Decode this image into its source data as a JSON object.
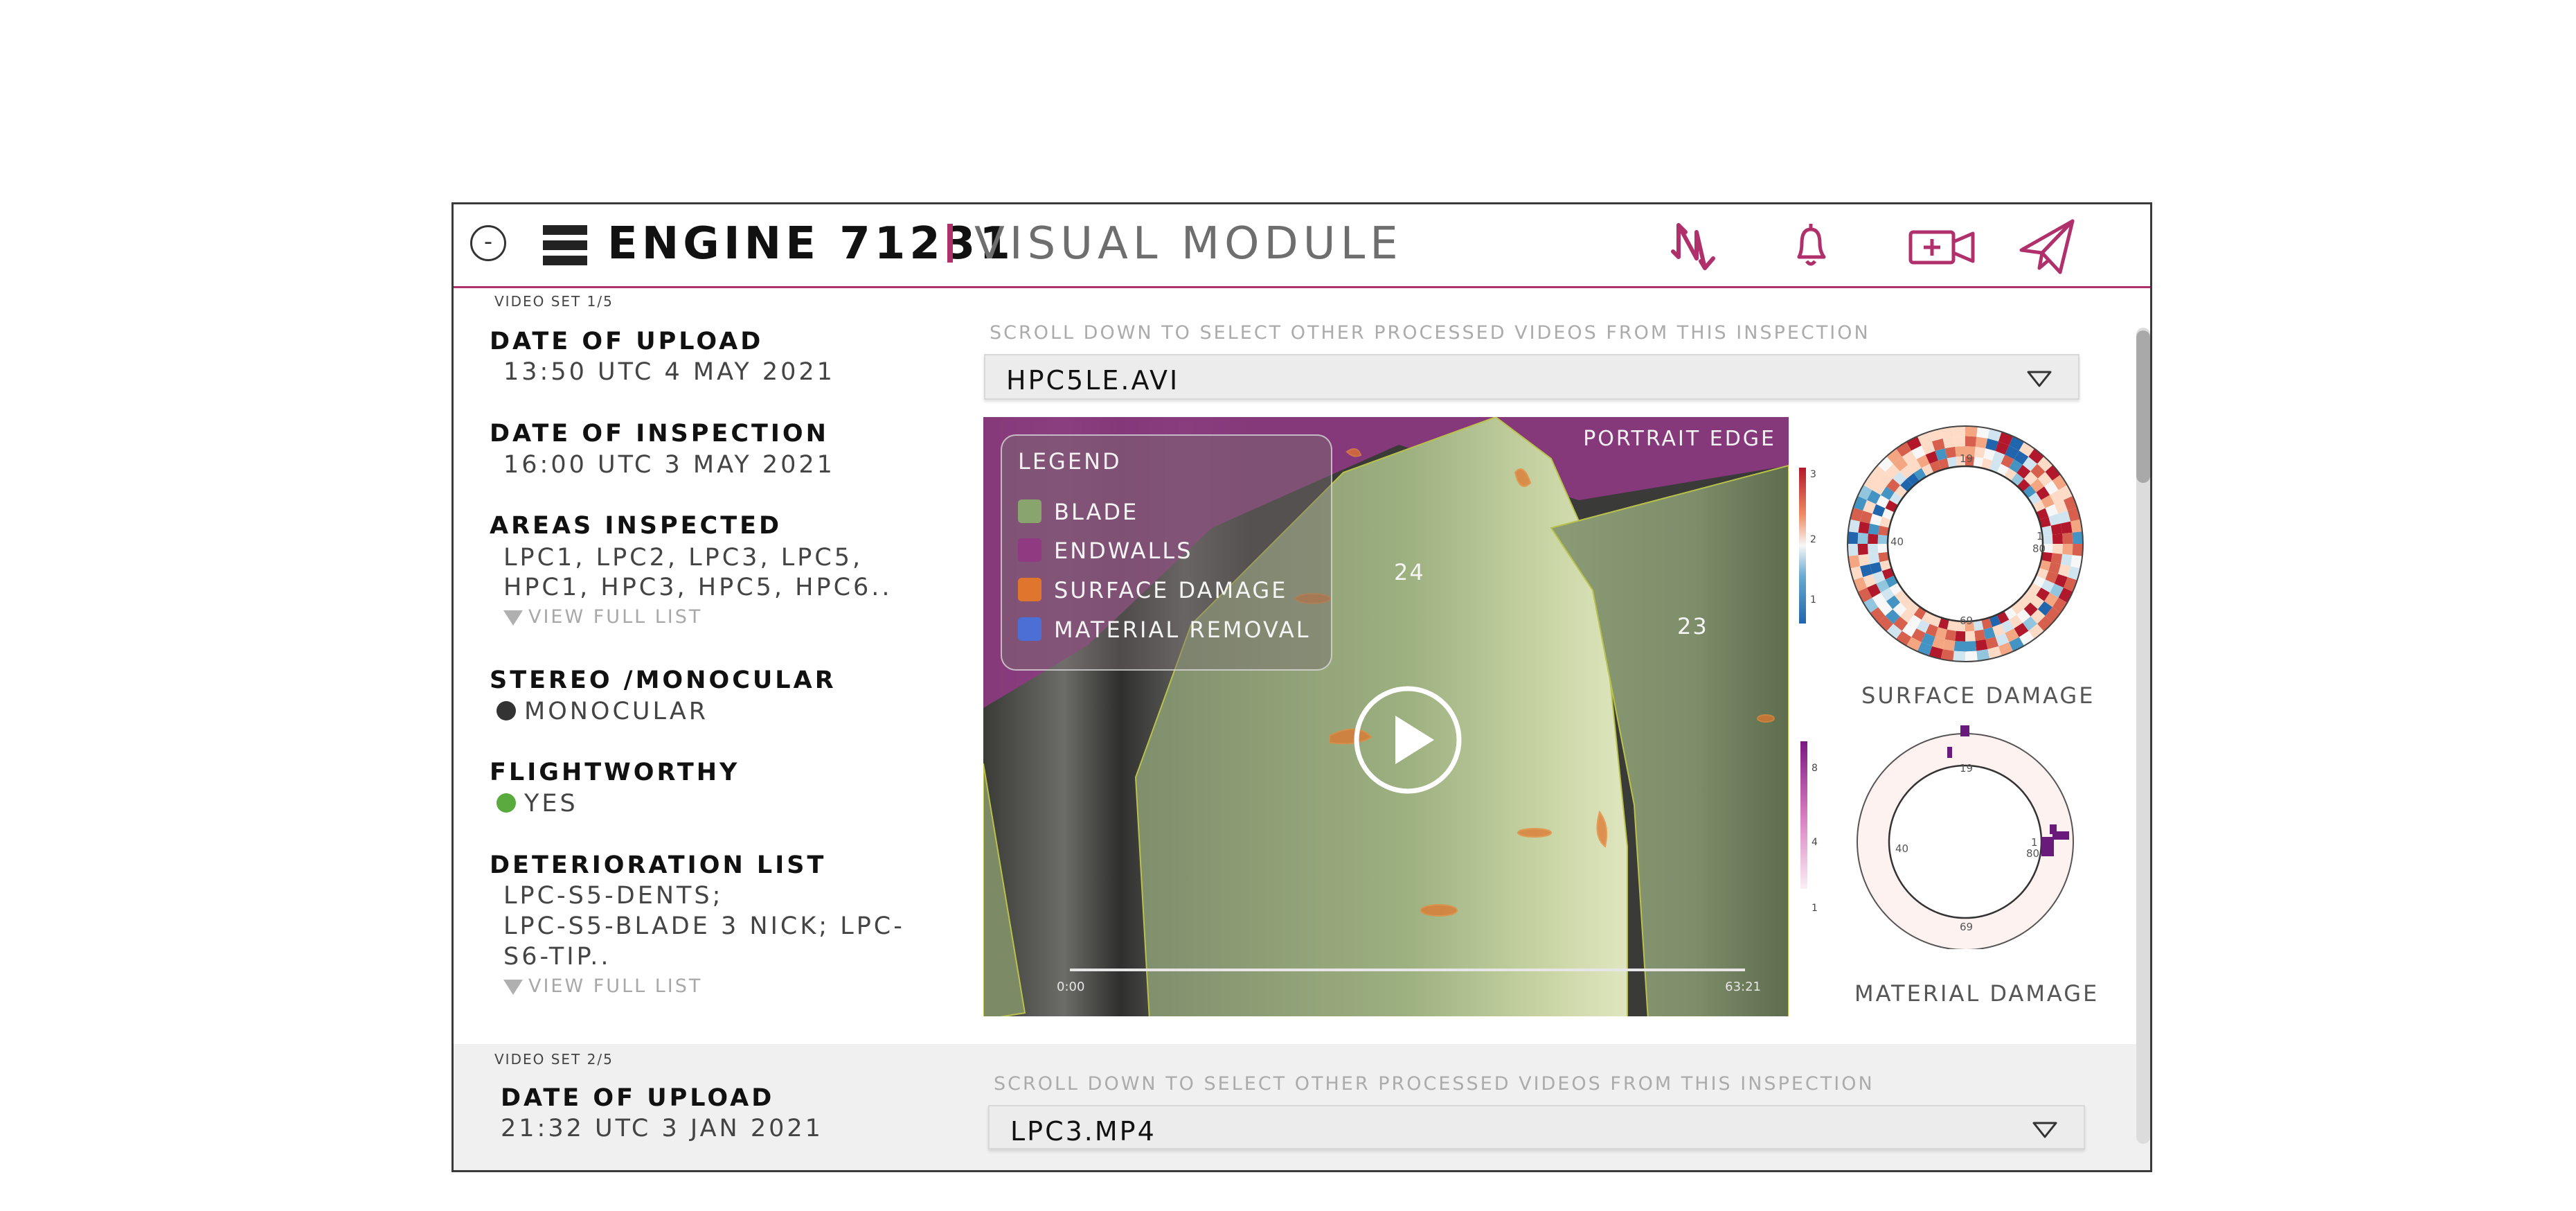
{
  "header": {
    "collapse_label": "-",
    "engine_title": "ENGINE 71231",
    "module_title": "VISUAL MODULE",
    "icons": [
      "switch-arrows-icon",
      "bell-icon",
      "add-video-icon",
      "send-icon"
    ]
  },
  "set1": {
    "set_label": "VIDEO SET 1/5",
    "upload_label": "DATE OF UPLOAD",
    "upload_value": "13:50 UTC 4 MAY 2021",
    "inspection_label": "DATE OF INSPECTION",
    "inspection_value": "16:00 UTC 3 MAY 2021",
    "areas_label": "AREAS INSPECTED",
    "areas_line1": "LPC1, LPC2, LPC3, LPC5,",
    "areas_line2": "HPC1, HPC3, HPC5, HPC6..",
    "view_full_list": "VIEW FULL LIST",
    "stereo_label": "STEREO /MONOCULAR",
    "stereo_value": "MONOCULAR",
    "flightworthy_label": "FLIGHTWORTHY",
    "flightworthy_value": "YES",
    "deterioration_label": "DETERIORATION LIST",
    "deterioration_line1": "LPC-S5-DENTS;",
    "deterioration_line2": "LPC-S5-BLADE 3 NICK; LPC-",
    "deterioration_line3": "S6-TIP..",
    "scroll_hint": "SCROLL DOWN TO SELECT OTHER PROCESSED VIDEOS FROM THIS INSPECTION",
    "selected_video": "HPC5LE.AVI"
  },
  "video": {
    "portrait_label": "PORTRAIT EDGE",
    "legend_title": "LEGEND",
    "legend": [
      {
        "label": "BLADE",
        "color": "#8aa46e"
      },
      {
        "label": "ENDWALLS",
        "color": "#8f3a82"
      },
      {
        "label": "SURFACE DAMAGE",
        "color": "#e0762e"
      },
      {
        "label": "MATERIAL REMOVAL",
        "color": "#4b6fd4"
      }
    ],
    "blade_labels": [
      "24",
      "23"
    ],
    "time_start": "0:00",
    "time_end": "63:21"
  },
  "charts": {
    "surface": {
      "caption": "SURFACE DAMAGE",
      "scale_ticks": [
        "3",
        "2",
        "1"
      ],
      "ring_labels": {
        "top": "19",
        "left": "40",
        "right_top": "1",
        "right": "80",
        "bottom": "69"
      }
    },
    "material": {
      "caption": "MATERIAL DAMAGE",
      "scale_ticks": [
        "8",
        "4",
        "1"
      ],
      "ring_labels": {
        "top": "19",
        "left": "40",
        "right_top": "1",
        "right": "80",
        "bottom": "69"
      }
    }
  },
  "set2": {
    "set_label": "VIDEO SET 2/5",
    "upload_label": "DATE OF UPLOAD",
    "upload_value": "21:32 UTC 3 JAN 2021",
    "scroll_hint": "SCROLL DOWN TO SELECT OTHER PROCESSED VIDEOS FROM THIS INSPECTION",
    "selected_video": "LPC3.MP4"
  },
  "colors": {
    "accent": "#b0306c",
    "flightworthy_dot": "#5aab3d",
    "stereo_dot": "#333333"
  }
}
